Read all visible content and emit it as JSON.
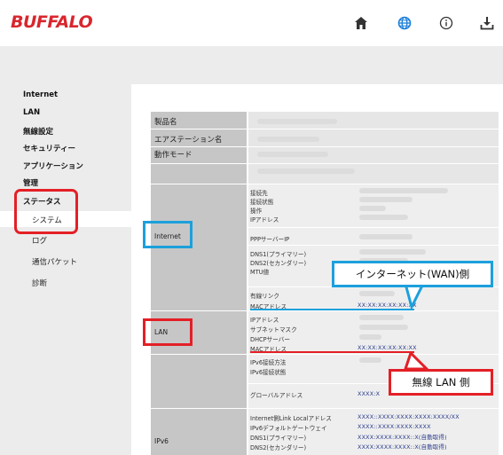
{
  "header": {
    "logo": "BUFFALO",
    "icons": [
      "home-icon",
      "globe-icon",
      "info-icon",
      "download-icon"
    ]
  },
  "sidebar": {
    "items": [
      "Internet",
      "LAN",
      "無線設定",
      "セキュリティー",
      "アプリケーション",
      "管理",
      "ステータス"
    ],
    "status_sub": [
      "システム",
      "ログ",
      "通信パケット",
      "診断"
    ],
    "active": "システム"
  },
  "table": {
    "top_labels": [
      "製品名",
      "エアステーション名",
      "動作モード"
    ],
    "internet_label": "Internet",
    "internet_fields_a": [
      "接続先",
      "接続状態",
      "操作",
      "IPアドレス"
    ],
    "internet_field_ppp": "PPPサーバーIP",
    "internet_fields_b": [
      "DNS1(プライマリー)",
      "DNS2(セカンダリー)",
      "MTU値"
    ],
    "internet_fields_c": [
      "有線リンク",
      "MACアドレス"
    ],
    "internet_mac": "XX:XX:XX:XX:XX:XX",
    "lan_label": "LAN",
    "lan_fields": [
      "IPアドレス",
      "サブネットマスク",
      "DHCPサーバー",
      "MACアドレス"
    ],
    "lan_mac": "XX:XX:XX:XX:XX:XX",
    "ipv6_label": "IPv6",
    "ipv6_fields_a": [
      "IPv6接続方法",
      "IPv6接続状態"
    ],
    "ipv6_field_global": "グローバルアドレス",
    "ipv6_global_value": "XXXX:X",
    "ipv6_fields_b": [
      "Internet側Link Localアドレス",
      "IPv6デフォルトゲートウェイ",
      "DNS1(プライマリー)",
      "DNS2(セカンダリー)"
    ],
    "ipv6_values_b": [
      "XXXX::XXXX:XXXX:XXXX:XXXX/XX",
      "XXXX::XXXX:XXXX:XXXX",
      "XXXX:XXXX:XXXX::X(自動取得)",
      "XXXX:XXXX:XXXX::X(自動取得)"
    ]
  },
  "annotations": {
    "wan_callout": "インターネット(WAN)側",
    "lan_callout": "無線 LAN 側"
  },
  "colors": {
    "brand": "#d8262d",
    "highlight_red": "#e41f26",
    "highlight_blue": "#1ca0dc",
    "accent_blue": "#1c7fd8"
  }
}
